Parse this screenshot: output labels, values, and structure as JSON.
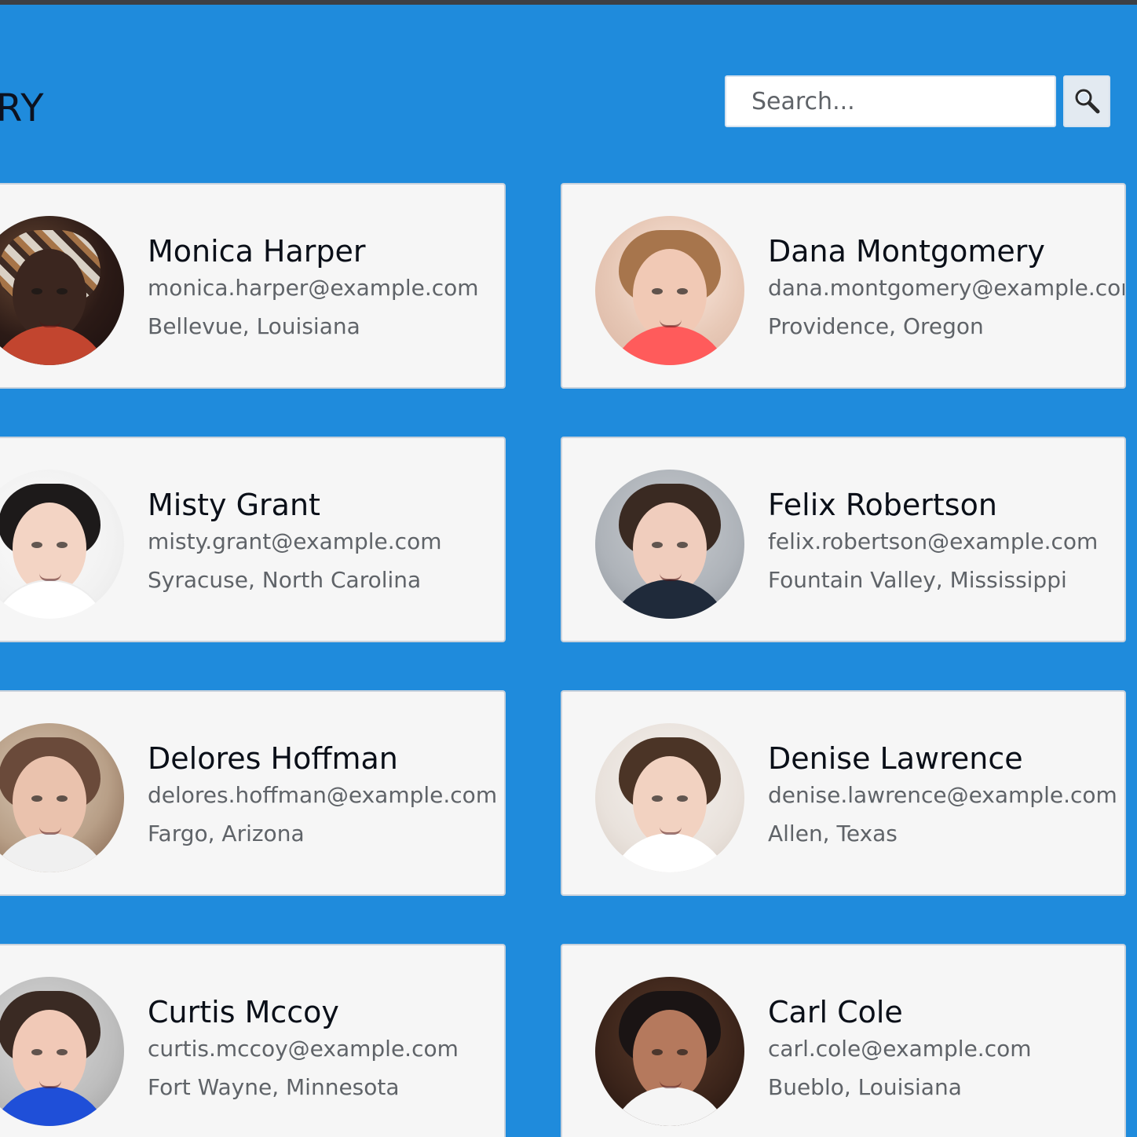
{
  "header": {
    "title_visible_text": "ECTORY",
    "search": {
      "placeholder": "Search...",
      "value": ""
    },
    "search_button_icon": "search-icon"
  },
  "people": [
    {
      "name": "Monica Harper",
      "email": "monica.harper@example.com",
      "location": "Bellevue, Louisiana"
    },
    {
      "name": "Dana Montgomery",
      "email": "dana.montgomery@example.com",
      "location": "Providence, Oregon"
    },
    {
      "name": "Misty Grant",
      "email": "misty.grant@example.com",
      "location": "Syracuse, North Carolina"
    },
    {
      "name": "Felix Robertson",
      "email": "felix.robertson@example.com",
      "location": "Fountain Valley, Mississippi"
    },
    {
      "name": "Delores Hoffman",
      "email": "delores.hoffman@example.com",
      "location": "Fargo, Arizona"
    },
    {
      "name": "Denise Lawrence",
      "email": "denise.lawrence@example.com",
      "location": "Allen, Texas"
    },
    {
      "name": "Curtis Mccoy",
      "email": "curtis.mccoy@example.com",
      "location": "Fort Wayne, Minnesota"
    },
    {
      "name": "Carl Cole",
      "email": "carl.cole@example.com",
      "location": "Bueblo, Louisiana"
    }
  ],
  "colors": {
    "page_background": "#1f8bdc",
    "card_background": "#f6f6f6",
    "card_border": "#c9d2dc",
    "text_primary": "#0a0f18",
    "text_secondary": "#5f6368"
  }
}
